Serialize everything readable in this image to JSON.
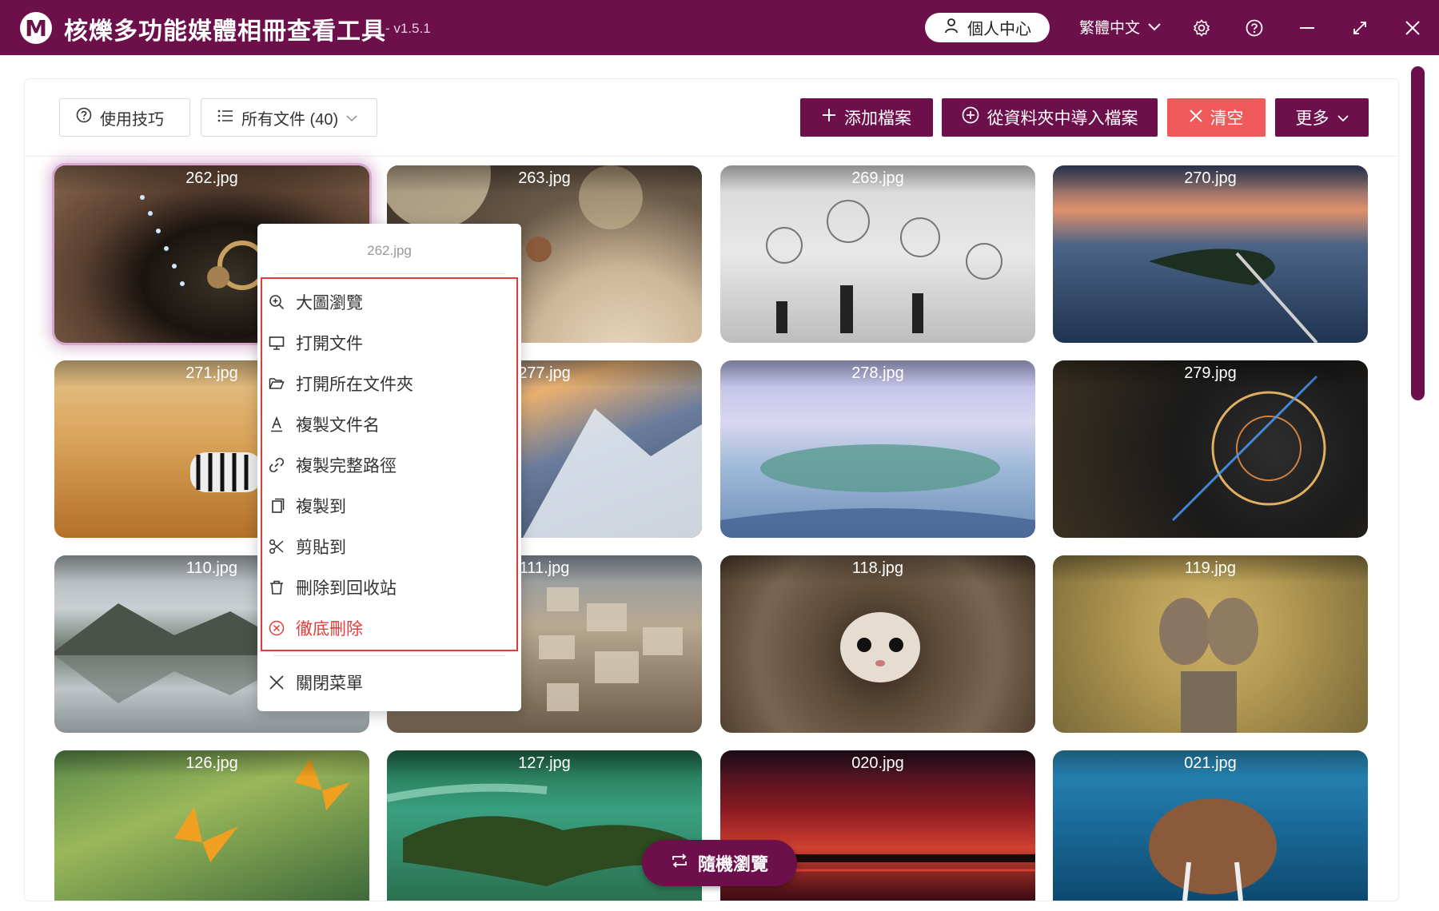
{
  "window": {
    "logo_letter": "M",
    "title": "核爍多功能媒體相冊查看工具",
    "version": "- v1.5.1",
    "user_center": "個人中心",
    "language": "繁體中文"
  },
  "toolbar": {
    "tips_label": "使用技巧",
    "filter_label": "所有文件 (40)",
    "add_label": "添加檔案",
    "import_label": "從資料夾中導入檔案",
    "clear_label": "清空",
    "more_label": "更多"
  },
  "images": [
    {
      "name": "262.jpg"
    },
    {
      "name": "263.jpg"
    },
    {
      "name": "269.jpg"
    },
    {
      "name": "270.jpg"
    },
    {
      "name": "271.jpg"
    },
    {
      "name": "277.jpg"
    },
    {
      "name": "278.jpg"
    },
    {
      "name": "279.jpg"
    },
    {
      "name": "110.jpg"
    },
    {
      "name": "111.jpg"
    },
    {
      "name": "118.jpg"
    },
    {
      "name": "119.jpg"
    },
    {
      "name": "126.jpg"
    },
    {
      "name": "127.jpg"
    },
    {
      "name": "020.jpg"
    },
    {
      "name": "021.jpg"
    }
  ],
  "context_menu": {
    "title": "262.jpg",
    "items": [
      {
        "label": "大圖瀏覽",
        "icon": "zoom-in-icon"
      },
      {
        "label": "打開文件",
        "icon": "monitor-icon"
      },
      {
        "label": "打開所在文件夾",
        "icon": "folder-open-icon"
      },
      {
        "label": "複製文件名",
        "icon": "text-a-icon"
      },
      {
        "label": "複製完整路徑",
        "icon": "link-icon"
      },
      {
        "label": "複製到",
        "icon": "copy-icon"
      },
      {
        "label": "剪貼到",
        "icon": "scissors-icon"
      },
      {
        "label": "刪除到回收站",
        "icon": "trash-icon"
      },
      {
        "label": "徹底刪除",
        "icon": "circle-x-icon"
      }
    ],
    "close_label": "關閉菜單"
  },
  "random_browse_label": "隨機瀏覽",
  "colors": {
    "brand": "#6d0f4a",
    "danger": "#f05a5a",
    "highlight_border": "#e03a3a"
  }
}
